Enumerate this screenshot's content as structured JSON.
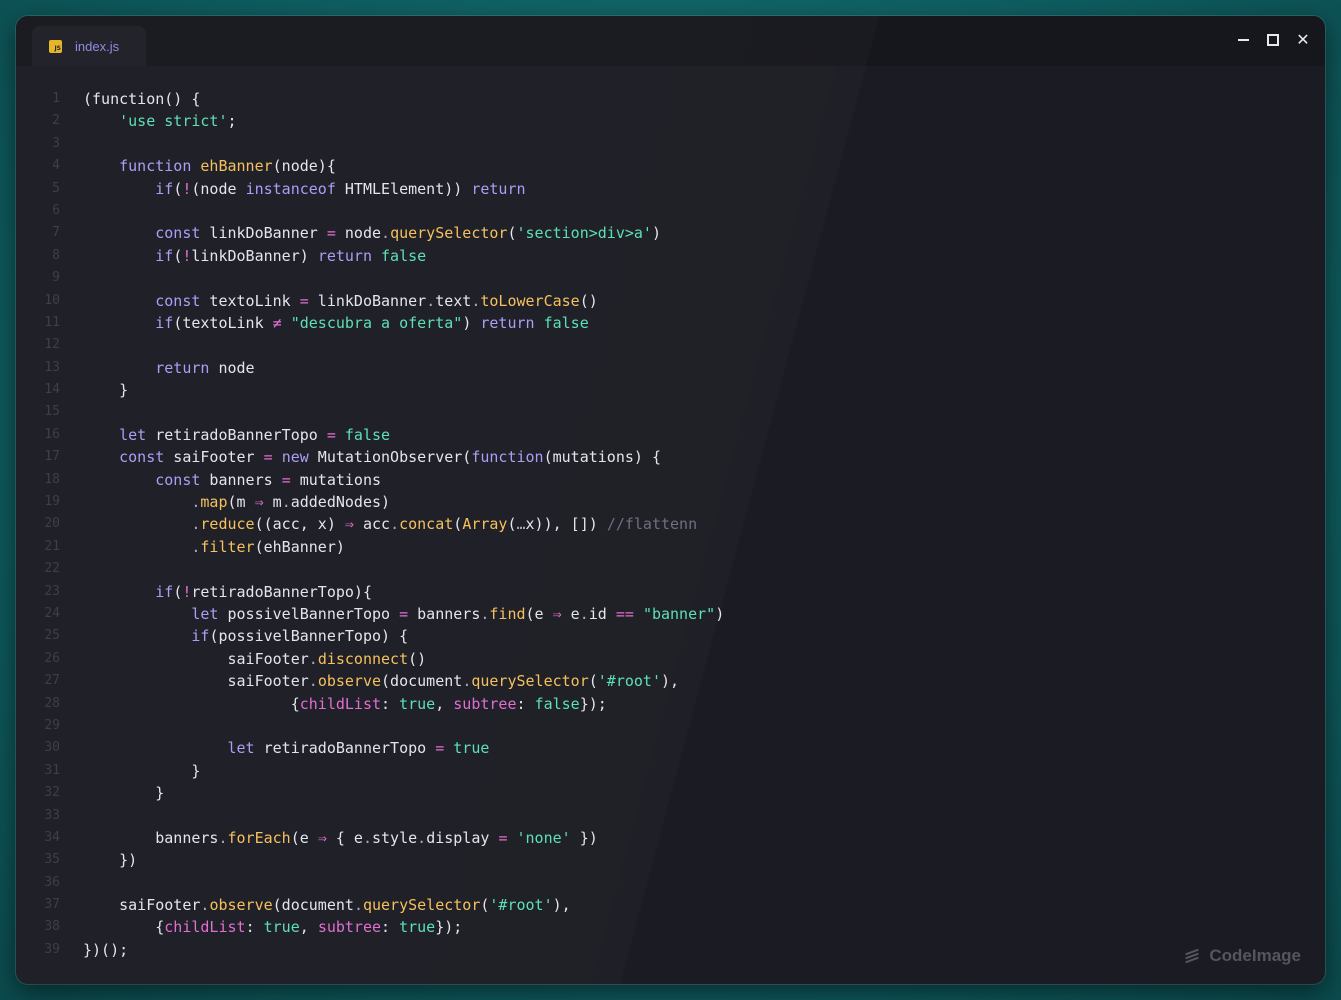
{
  "tab": {
    "label": "index.js",
    "icon": "javascript-file-icon"
  },
  "window_controls": [
    "minimize",
    "maximize",
    "close"
  ],
  "watermark": "CodeImage",
  "lines": [
    {
      "n": "1",
      "t": [
        [
          "p",
          "(function() {"
        ]
      ]
    },
    {
      "n": "2",
      "t": [
        [
          "p",
          "    "
        ],
        [
          "str",
          "'use strict'"
        ],
        [
          "p",
          ";"
        ]
      ]
    },
    {
      "n": "3",
      "t": []
    },
    {
      "n": "4",
      "t": [
        [
          "p",
          "    "
        ],
        [
          "kw",
          "function"
        ],
        [
          "p",
          " "
        ],
        [
          "fn",
          "ehBanner"
        ],
        [
          "p",
          "(node){"
        ]
      ]
    },
    {
      "n": "5",
      "t": [
        [
          "p",
          "        "
        ],
        [
          "kw",
          "if"
        ],
        [
          "p",
          "("
        ],
        [
          "op",
          "!"
        ],
        [
          "p",
          "(node "
        ],
        [
          "kw",
          "instanceof"
        ],
        [
          "p",
          " HTMLElement)) "
        ],
        [
          "kw",
          "return"
        ]
      ]
    },
    {
      "n": "6",
      "t": []
    },
    {
      "n": "7",
      "t": [
        [
          "p",
          "        "
        ],
        [
          "kw",
          "const"
        ],
        [
          "p",
          " linkDoBanner "
        ],
        [
          "op",
          "="
        ],
        [
          "p",
          " node"
        ],
        [
          "dot",
          "."
        ],
        [
          "fn",
          "querySelector"
        ],
        [
          "p",
          "("
        ],
        [
          "str",
          "'section>div>a'"
        ],
        [
          "p",
          ")"
        ]
      ]
    },
    {
      "n": "8",
      "t": [
        [
          "p",
          "        "
        ],
        [
          "kw",
          "if"
        ],
        [
          "p",
          "("
        ],
        [
          "op",
          "!"
        ],
        [
          "p",
          "linkDoBanner) "
        ],
        [
          "kw",
          "return"
        ],
        [
          "p",
          " "
        ],
        [
          "bool",
          "false"
        ]
      ]
    },
    {
      "n": "9",
      "t": []
    },
    {
      "n": "10",
      "t": [
        [
          "p",
          "        "
        ],
        [
          "kw",
          "const"
        ],
        [
          "p",
          " textoLink "
        ],
        [
          "op",
          "="
        ],
        [
          "p",
          " linkDoBanner"
        ],
        [
          "dot",
          "."
        ],
        [
          "p",
          "text"
        ],
        [
          "dot",
          "."
        ],
        [
          "fn",
          "toLowerCase"
        ],
        [
          "p",
          "()"
        ]
      ]
    },
    {
      "n": "11",
      "t": [
        [
          "p",
          "        "
        ],
        [
          "kw",
          "if"
        ],
        [
          "p",
          "(textoLink "
        ],
        [
          "op",
          "≠"
        ],
        [
          "p",
          " "
        ],
        [
          "str",
          "\"descubra a oferta\""
        ],
        [
          "p",
          ") "
        ],
        [
          "kw",
          "return"
        ],
        [
          "p",
          " "
        ],
        [
          "bool",
          "false"
        ]
      ]
    },
    {
      "n": "12",
      "t": []
    },
    {
      "n": "13",
      "t": [
        [
          "p",
          "        "
        ],
        [
          "kw",
          "return"
        ],
        [
          "p",
          " node"
        ]
      ]
    },
    {
      "n": "14",
      "t": [
        [
          "p",
          "    }"
        ]
      ]
    },
    {
      "n": "15",
      "t": []
    },
    {
      "n": "16",
      "t": [
        [
          "p",
          "    "
        ],
        [
          "kw",
          "let"
        ],
        [
          "p",
          " retiradoBannerTopo "
        ],
        [
          "op",
          "="
        ],
        [
          "p",
          " "
        ],
        [
          "bool",
          "false"
        ]
      ]
    },
    {
      "n": "17",
      "t": [
        [
          "p",
          "    "
        ],
        [
          "kw",
          "const"
        ],
        [
          "p",
          " saiFooter "
        ],
        [
          "op",
          "="
        ],
        [
          "p",
          " "
        ],
        [
          "kw",
          "new"
        ],
        [
          "p",
          " MutationObserver("
        ],
        [
          "kw",
          "function"
        ],
        [
          "p",
          "(mutations) {"
        ]
      ]
    },
    {
      "n": "18",
      "t": [
        [
          "p",
          "        "
        ],
        [
          "kw",
          "const"
        ],
        [
          "p",
          " banners "
        ],
        [
          "op",
          "="
        ],
        [
          "p",
          " mutations"
        ]
      ]
    },
    {
      "n": "19",
      "t": [
        [
          "p",
          "            "
        ],
        [
          "dot",
          "."
        ],
        [
          "fn",
          "map"
        ],
        [
          "p",
          "(m "
        ],
        [
          "op",
          "⇒"
        ],
        [
          "p",
          " m"
        ],
        [
          "dot",
          "."
        ],
        [
          "p",
          "addedNodes)"
        ]
      ]
    },
    {
      "n": "20",
      "t": [
        [
          "p",
          "            "
        ],
        [
          "dot",
          "."
        ],
        [
          "fn",
          "reduce"
        ],
        [
          "p",
          "((acc, x) "
        ],
        [
          "op",
          "⇒"
        ],
        [
          "p",
          " acc"
        ],
        [
          "dot",
          "."
        ],
        [
          "fn",
          "concat"
        ],
        [
          "p",
          "("
        ],
        [
          "fn",
          "Array"
        ],
        [
          "p",
          "("
        ],
        [
          "dot",
          "…"
        ],
        [
          "p",
          "x)), []) "
        ],
        [
          "cmt",
          "//flattenn"
        ]
      ]
    },
    {
      "n": "21",
      "t": [
        [
          "p",
          "            "
        ],
        [
          "dot",
          "."
        ],
        [
          "fn",
          "filter"
        ],
        [
          "p",
          "(ehBanner)"
        ]
      ]
    },
    {
      "n": "22",
      "t": []
    },
    {
      "n": "23",
      "t": [
        [
          "p",
          "        "
        ],
        [
          "kw",
          "if"
        ],
        [
          "p",
          "("
        ],
        [
          "op",
          "!"
        ],
        [
          "p",
          "retiradoBannerTopo){"
        ]
      ]
    },
    {
      "n": "24",
      "t": [
        [
          "p",
          "            "
        ],
        [
          "kw",
          "let"
        ],
        [
          "p",
          " possivelBannerTopo "
        ],
        [
          "op",
          "="
        ],
        [
          "p",
          " banners"
        ],
        [
          "dot",
          "."
        ],
        [
          "fn",
          "find"
        ],
        [
          "p",
          "(e "
        ],
        [
          "op",
          "⇒"
        ],
        [
          "p",
          " e"
        ],
        [
          "dot",
          "."
        ],
        [
          "p",
          "id "
        ],
        [
          "op",
          "=="
        ],
        [
          "p",
          " "
        ],
        [
          "str",
          "\"banner\""
        ],
        [
          "p",
          ")"
        ]
      ]
    },
    {
      "n": "25",
      "t": [
        [
          "p",
          "            "
        ],
        [
          "kw",
          "if"
        ],
        [
          "p",
          "(possivelBannerTopo) {"
        ]
      ]
    },
    {
      "n": "26",
      "t": [
        [
          "p",
          "                saiFooter"
        ],
        [
          "dot",
          "."
        ],
        [
          "fn",
          "disconnect"
        ],
        [
          "p",
          "()"
        ]
      ]
    },
    {
      "n": "27",
      "t": [
        [
          "p",
          "                saiFooter"
        ],
        [
          "dot",
          "."
        ],
        [
          "fn",
          "observe"
        ],
        [
          "p",
          "(document"
        ],
        [
          "dot",
          "."
        ],
        [
          "fn",
          "querySelector"
        ],
        [
          "p",
          "("
        ],
        [
          "str",
          "'#root'"
        ],
        [
          "p",
          "),"
        ]
      ]
    },
    {
      "n": "28",
      "t": [
        [
          "p",
          "                       {"
        ],
        [
          "prop",
          "childList"
        ],
        [
          "p",
          ": "
        ],
        [
          "bool",
          "true"
        ],
        [
          "p",
          ", "
        ],
        [
          "prop",
          "subtree"
        ],
        [
          "p",
          ": "
        ],
        [
          "bool",
          "false"
        ],
        [
          "p",
          "});"
        ]
      ]
    },
    {
      "n": "29",
      "t": []
    },
    {
      "n": "30",
      "t": [
        [
          "p",
          "                "
        ],
        [
          "kw",
          "let"
        ],
        [
          "p",
          " retiradoBannerTopo "
        ],
        [
          "op",
          "="
        ],
        [
          "p",
          " "
        ],
        [
          "bool",
          "true"
        ]
      ]
    },
    {
      "n": "31",
      "t": [
        [
          "p",
          "            }"
        ]
      ]
    },
    {
      "n": "32",
      "t": [
        [
          "p",
          "        }"
        ]
      ]
    },
    {
      "n": "33",
      "t": []
    },
    {
      "n": "34",
      "t": [
        [
          "p",
          "        banners"
        ],
        [
          "dot",
          "."
        ],
        [
          "fn",
          "forEach"
        ],
        [
          "p",
          "(e "
        ],
        [
          "op",
          "⇒"
        ],
        [
          "p",
          " { e"
        ],
        [
          "dot",
          "."
        ],
        [
          "p",
          "style"
        ],
        [
          "dot",
          "."
        ],
        [
          "p",
          "display "
        ],
        [
          "op",
          "="
        ],
        [
          "p",
          " "
        ],
        [
          "str",
          "'none'"
        ],
        [
          "p",
          " })"
        ]
      ]
    },
    {
      "n": "35",
      "t": [
        [
          "p",
          "    })"
        ]
      ]
    },
    {
      "n": "36",
      "t": []
    },
    {
      "n": "37",
      "t": [
        [
          "p",
          "    saiFooter"
        ],
        [
          "dot",
          "."
        ],
        [
          "fn",
          "observe"
        ],
        [
          "p",
          "(document"
        ],
        [
          "dot",
          "."
        ],
        [
          "fn",
          "querySelector"
        ],
        [
          "p",
          "("
        ],
        [
          "str",
          "'#root'"
        ],
        [
          "p",
          "),"
        ]
      ]
    },
    {
      "n": "38",
      "t": [
        [
          "p",
          "        {"
        ],
        [
          "prop",
          "childList"
        ],
        [
          "p",
          ": "
        ],
        [
          "bool",
          "true"
        ],
        [
          "p",
          ", "
        ],
        [
          "prop",
          "subtree"
        ],
        [
          "p",
          ": "
        ],
        [
          "bool",
          "true"
        ],
        [
          "p",
          "});"
        ]
      ]
    },
    {
      "n": "39",
      "t": [
        [
          "p",
          "})();"
        ]
      ]
    }
  ]
}
